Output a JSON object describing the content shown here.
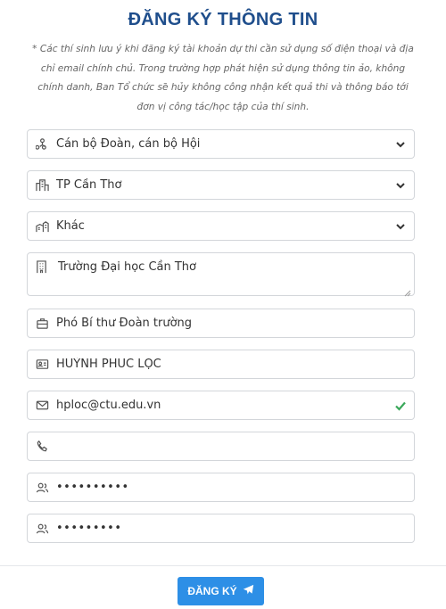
{
  "title": "ĐĂNG KÝ THÔNG TIN",
  "note": "* Các thí sinh lưu ý khi đăng ký tài khoản dự thi cần sử dụng số điện thoại và địa chỉ email chính chủ. Trong trường hợp phát hiện sử dụng thông tin ảo, không chính danh, Ban Tổ chức sẽ hủy không công nhận kết quả thi và thông báo tới đơn vị công tác/học tập của thí sinh.",
  "form": {
    "object_type": {
      "value": "Cán bộ Đoàn, cán bộ Hội",
      "icon": "person-network-icon"
    },
    "province": {
      "value": "TP Cần Thơ",
      "icon": "city-icon"
    },
    "unit_type": {
      "value": "Khác",
      "icon": "buildings-icon"
    },
    "unit_name": {
      "value": "Trường Đại học Cần Thơ",
      "icon": "building-icon"
    },
    "position": {
      "value": "Phó Bí thư Đoàn trường",
      "icon": "briefcase-icon"
    },
    "full_name": {
      "value": "HUỲNH PHÚC LỘC",
      "icon": "id-card-icon"
    },
    "email": {
      "value": "hploc@ctu.edu.vn",
      "icon": "mail-icon",
      "valid_color": "#3aa85a"
    },
    "phone": {
      "value": "",
      "icon": "phone-icon"
    },
    "password": {
      "value": "••••••••••",
      "icon": "users-icon"
    },
    "password_confirm": {
      "value": "•••••••••",
      "icon": "users-icon"
    }
  },
  "submit_label": "ĐĂNG KÝ",
  "colors": {
    "title": "#1f4e8c",
    "button": "#2d8fe6"
  }
}
